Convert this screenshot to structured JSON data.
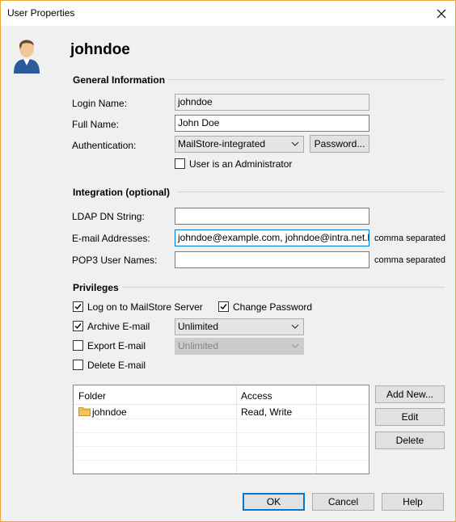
{
  "window": {
    "title": "User Properties"
  },
  "user": {
    "name": "johndoe"
  },
  "general": {
    "section_title": "General Information",
    "login_label": "Login Name:",
    "login_value": "johndoe",
    "fullname_label": "Full Name:",
    "fullname_value": "John Doe",
    "auth_label": "Authentication:",
    "auth_value": "MailStore-integrated",
    "password_button": "Password...",
    "admin_label": "User is an Administrator",
    "admin_checked": false
  },
  "integration": {
    "section_title": "Integration (optional)",
    "ldap_label": "LDAP DN String:",
    "ldap_value": "",
    "email_label": "E-mail Addresses:",
    "email_value": "johndoe@example.com, johndoe@intra.net.lan",
    "email_hint": "comma separated",
    "pop3_label": "POP3 User Names:",
    "pop3_value": "",
    "pop3_hint": "comma separated"
  },
  "privileges": {
    "section_title": "Privileges",
    "logon_label": "Log on to MailStore Server",
    "logon_checked": true,
    "change_pw_label": "Change Password",
    "change_pw_checked": true,
    "archive_label": "Archive E-mail",
    "archive_checked": true,
    "archive_value": "Unlimited",
    "export_label": "Export E-mail",
    "export_checked": false,
    "export_value": "Unlimited",
    "delete_label": "Delete E-mail",
    "delete_checked": false
  },
  "folders": {
    "columns": [
      "Folder",
      "Access"
    ],
    "rows": [
      {
        "folder": "johndoe",
        "access": "Read, Write"
      }
    ],
    "add_button": "Add New...",
    "edit_button": "Edit",
    "delete_button": "Delete"
  },
  "footer": {
    "ok": "OK",
    "cancel": "Cancel",
    "help": "Help"
  },
  "colors": {
    "accent": "#0078d7",
    "window_border": "#e8a736",
    "dialog_bg": "#f0f0f0"
  },
  "icons": {
    "user": "user-avatar-icon",
    "folder": "folder-icon",
    "close": "close-icon",
    "dropdown": "chevron-down-icon",
    "check": "checkmark-icon"
  }
}
